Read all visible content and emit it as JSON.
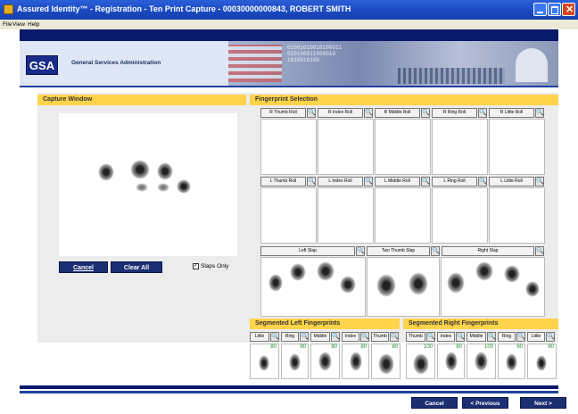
{
  "window": {
    "title": "Assured Identity™ - Registration - Ten Print Capture - 00030000000843, ROBERT SMITH"
  },
  "menu": [
    "File",
    "View",
    "Help"
  ],
  "header": {
    "logo": "GSA",
    "agency": "General Services Administration",
    "banner_binary": "01001010010100011\n010100011000010\n1010010100"
  },
  "capture": {
    "title": "Capture Window",
    "cancel_label": "Cancel",
    "clear_all_label": "Clear All",
    "slaps_only_label": "Slaps Only",
    "slaps_only_checked": true
  },
  "selection": {
    "title": "Fingerprint Selection",
    "right_rolls": [
      "R Thumb Roll",
      "R Index Roll",
      "R Middle Roll",
      "R Ring Roll",
      "R Little Roll"
    ],
    "left_rolls": [
      "L Thumb Roll",
      "L Index Roll",
      "L Middle Roll",
      "L Ring Roll",
      "L Little Roll"
    ],
    "slaps": [
      "Left Slap",
      "Two Thumb Slap",
      "Right Slap"
    ]
  },
  "segmented_left": {
    "title": "Segmented Left Fingerprints",
    "fingers": [
      "Little",
      "Ring",
      "Middle",
      "Index",
      "Thumb"
    ],
    "scores": [
      "80",
      "80",
      "80",
      "80",
      "80"
    ]
  },
  "segmented_right": {
    "title": "Segmented Right Fingerprints",
    "fingers": [
      "Thumb",
      "Index",
      "Middle",
      "Ring",
      "Little"
    ],
    "scores": [
      "100",
      "80",
      "100",
      "60",
      "80"
    ]
  },
  "nav": {
    "cancel_label": "Cancel",
    "previous_label": "< Previous",
    "next_label": "Next >"
  },
  "colors": {
    "title_bar": "#1a49c0",
    "button_navy": "#1c2f72",
    "section_header": "#ffd34a",
    "score_text": "#1a8a2a"
  }
}
